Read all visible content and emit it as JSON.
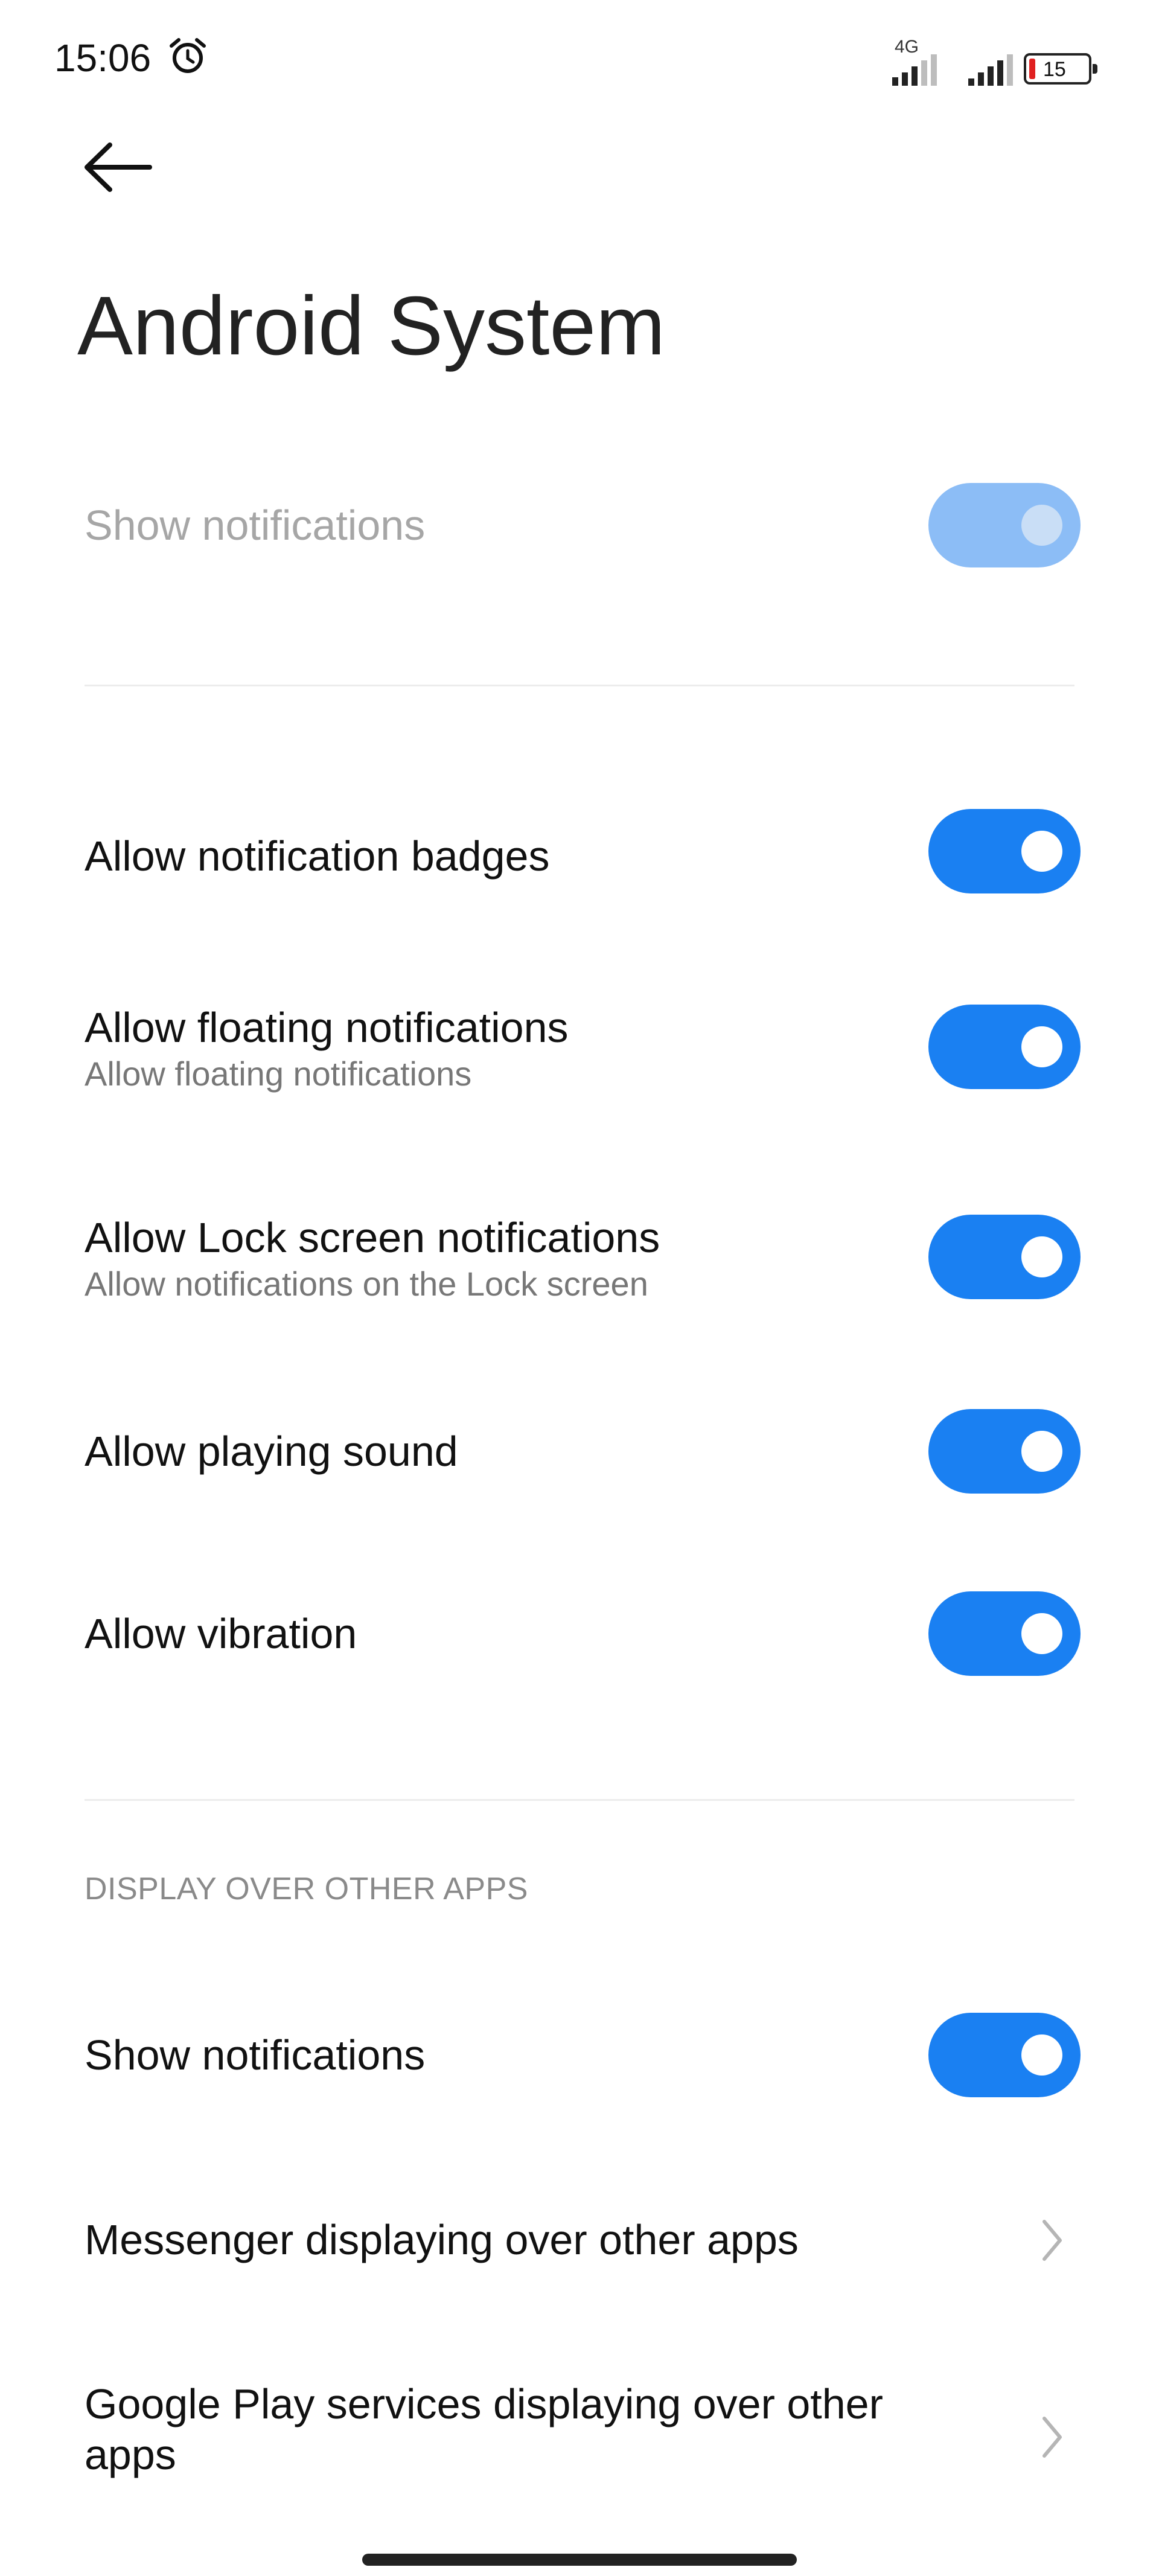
{
  "status_bar": {
    "time": "15:06",
    "alarm_icon": "alarm-clock-icon",
    "network_label": "4G",
    "battery_level": "15"
  },
  "header": {
    "back_icon": "arrow-left-icon",
    "title": "Android System"
  },
  "main": {
    "show_notifications": {
      "label": "Show notifications",
      "enabled": false,
      "on": true
    },
    "items": [
      {
        "label": "Allow notification badges",
        "subtitle": "",
        "on": true
      },
      {
        "label": "Allow floating notifications",
        "subtitle": "Allow floating notifications",
        "on": true
      },
      {
        "label": "Allow Lock screen notifications",
        "subtitle": "Allow notifications on the Lock screen",
        "on": true
      },
      {
        "label": "Allow playing sound",
        "subtitle": "",
        "on": true
      },
      {
        "label": "Allow vibration",
        "subtitle": "",
        "on": true
      }
    ],
    "display_section": {
      "header": "DISPLAY OVER OTHER APPS",
      "show_notifications": {
        "label": "Show notifications",
        "on": true
      },
      "links": [
        {
          "label": "Messenger displaying over other apps",
          "icon": "chevron-right-icon"
        },
        {
          "label": "Google Play services displaying over other apps",
          "icon": "chevron-right-icon"
        }
      ]
    }
  },
  "colors": {
    "accent": "#1a80f2",
    "accent_disabled": "#8cbdf6",
    "text_primary": "#111111",
    "text_secondary": "#777777",
    "divider": "#ececec"
  }
}
